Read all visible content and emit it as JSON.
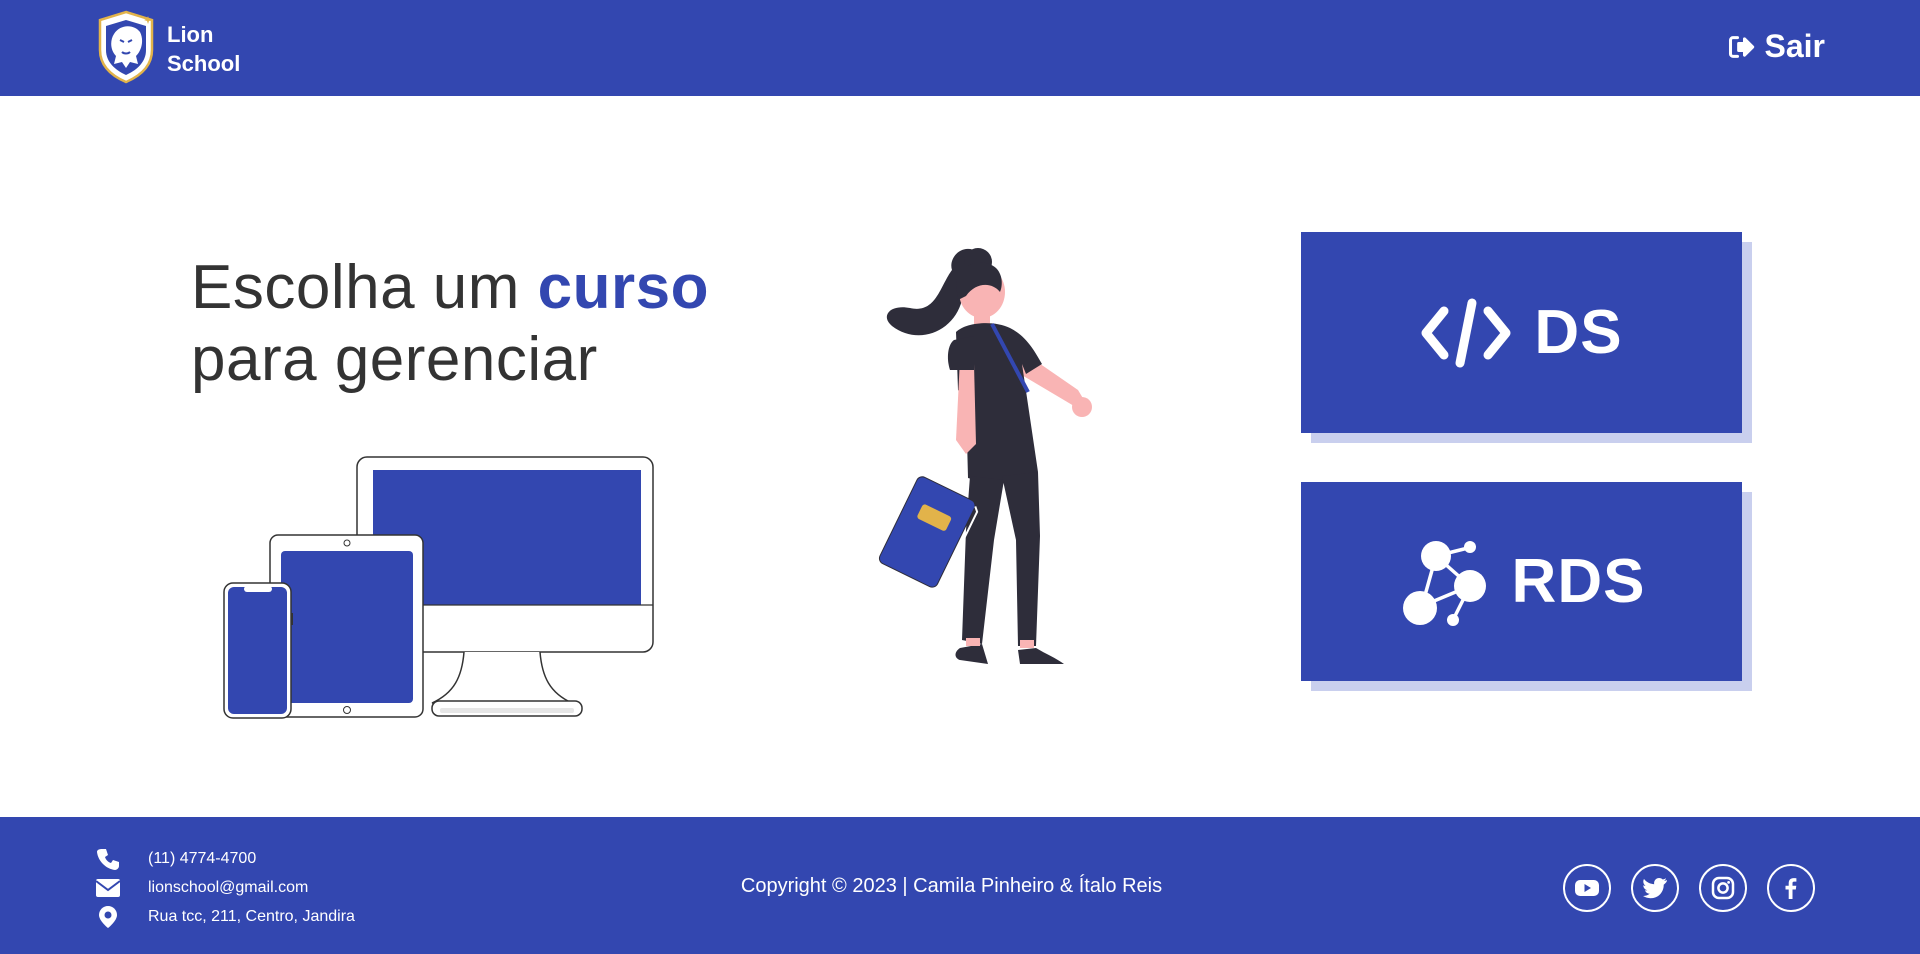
{
  "header": {
    "brand_line1": "Lion",
    "brand_line2": "School",
    "logout_label": "Sair"
  },
  "main": {
    "headline_part1": "Escolha um ",
    "headline_accent": "curso",
    "headline_part2": "para gerenciar",
    "courses": [
      {
        "label": "DS",
        "icon": "code-icon"
      },
      {
        "label": "RDS",
        "icon": "network-icon"
      }
    ]
  },
  "footer": {
    "phone": "(11) 4774-4700",
    "email": "lionschool@gmail.com",
    "address": "Rua tcc, 211, Centro, Jandira",
    "copyright": "Copyright © 2023 | Camila Pinheiro & Ítalo Reis",
    "social": [
      "youtube-icon",
      "twitter-icon",
      "instagram-icon",
      "facebook-icon"
    ]
  },
  "colors": {
    "primary": "#3347b0",
    "shadow": "#c9cfee",
    "text": "#333333",
    "accent_gold": "#e2b34a",
    "skin": "#f9b4b4",
    "dark": "#2e2d3a"
  }
}
